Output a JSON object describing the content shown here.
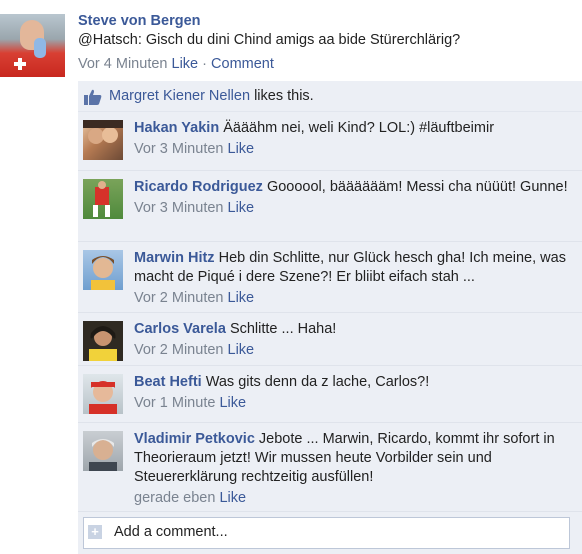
{
  "post": {
    "author": "Steve von Bergen",
    "text": "@Hatsch: Gisch du dini Chind amigs aa bide Stürerchlärig?",
    "time": "Vor 4 Minuten",
    "like_label": "Like",
    "separator": "·",
    "comment_label": "Comment"
  },
  "likes": {
    "name": "Margret Kiener Nellen",
    "suffix": "likes this."
  },
  "comments": [
    {
      "name": "Hakan Yakin",
      "text": "Äääähm nei, weli Kind? LOL:) #läuftbeimir",
      "time": "Vor 3 Minuten",
      "like": "Like"
    },
    {
      "name": "Ricardo Rodriguez",
      "text": "Goooool, bääääääm! Messi cha nüüüt! Gunne!",
      "time": "Vor 3 Minuten",
      "like": "Like"
    },
    {
      "name": "Marwin Hitz",
      "text": "Heb din Schlitte, nur Glück hesch gha! Ich meine, was macht de Piqué i dere Szene?! Er bliibt eifach stah ...",
      "time": "Vor 2 Minuten",
      "like": "Like"
    },
    {
      "name": "Carlos Varela",
      "text": "Schlitte ... Haha!",
      "time": "Vor 2 Minuten",
      "like": "Like"
    },
    {
      "name": "Beat Hefti",
      "text": "Was gits denn da z lache, Carlos?!",
      "time": "Vor 1 Minute",
      "like": "Like"
    },
    {
      "name": "Vladimir Petkovic",
      "text": "Jebote ... Marwin, Ricardo, kommt ihr sofort in Theorieraum jetzt! Wir mussen heute Vorbilder sein und Steuererklärung rechtzeitig ausfüllen!",
      "time": "gerade eben",
      "like": "Like"
    }
  ],
  "add_comment": {
    "placeholder": "Add a comment..."
  },
  "colors": {
    "link": "#3b5998",
    "panel": "#eceff5",
    "meta": "#7a8390"
  }
}
